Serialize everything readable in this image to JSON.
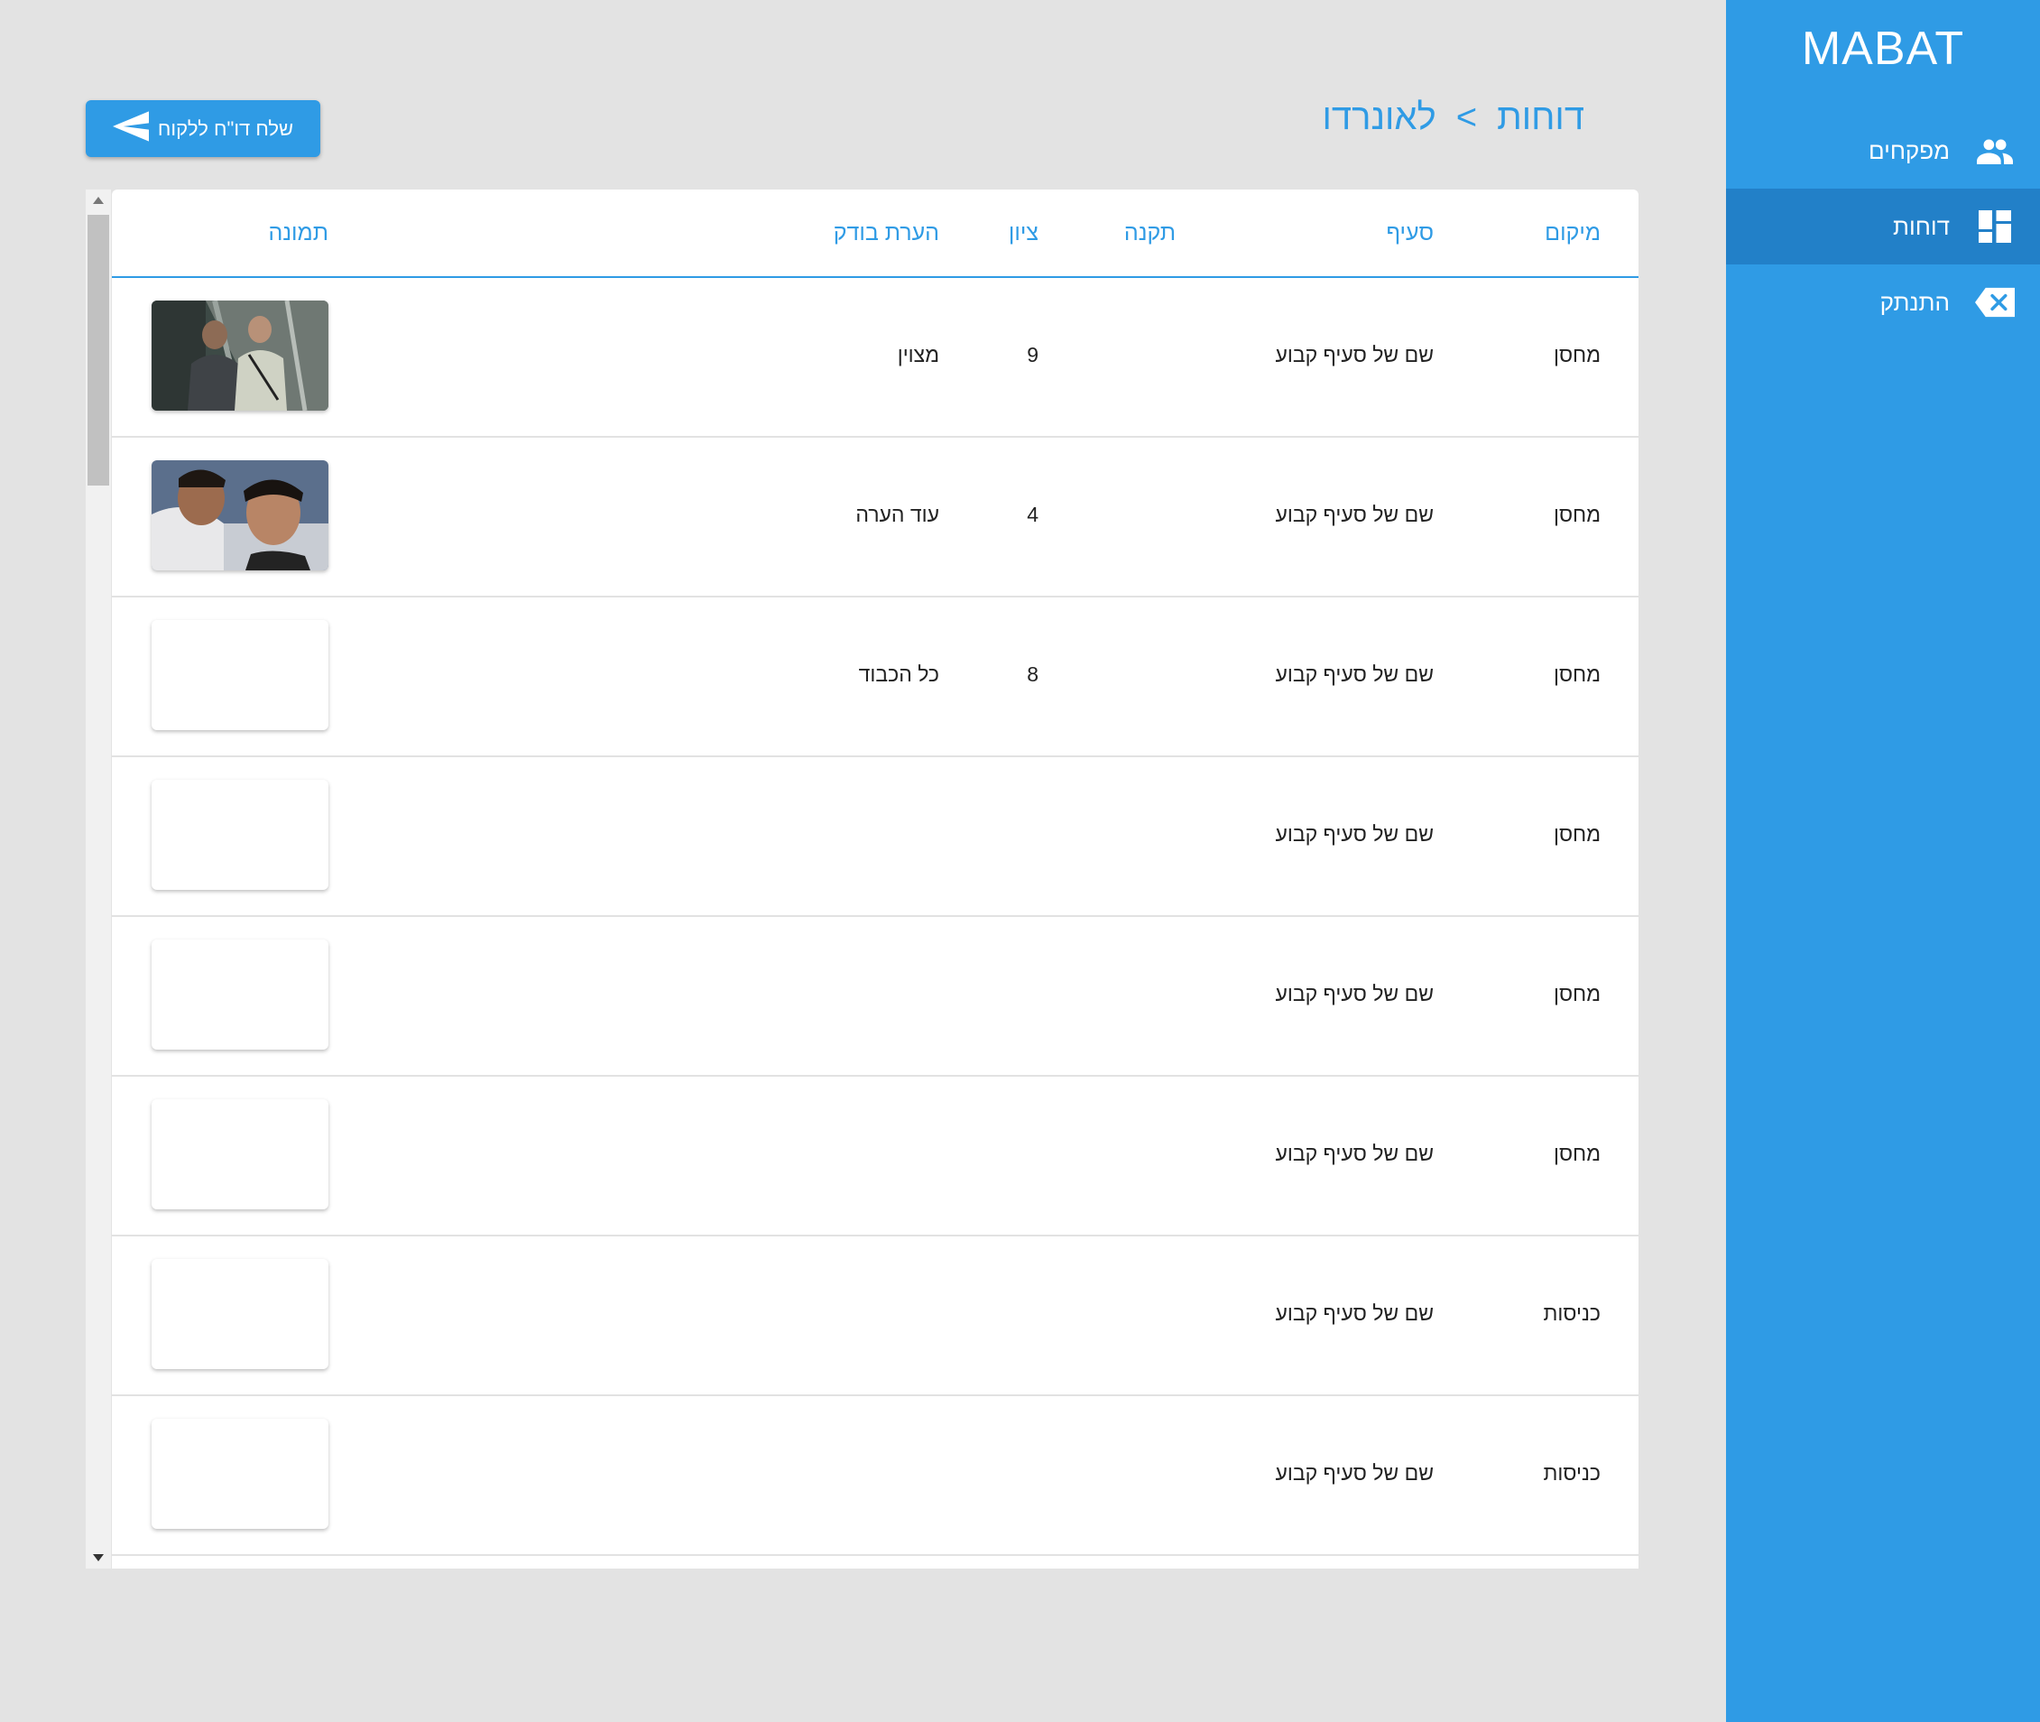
{
  "sidebar": {
    "brand": "MABAT",
    "items": [
      {
        "label": "מפקחים",
        "icon": "people-icon",
        "active": false
      },
      {
        "label": "דוחות",
        "icon": "dashboard-icon",
        "active": true
      },
      {
        "label": "התנתק",
        "icon": "backspace-icon",
        "active": false
      }
    ]
  },
  "header": {
    "breadcrumb": [
      "דוחות",
      ">",
      "לאונרדו"
    ],
    "send_button": {
      "label": "שלח דו\"ח ללקוח",
      "icon": "send-icon"
    }
  },
  "table": {
    "columns": {
      "location": "מיקום",
      "section": "סעיף",
      "regulation": "תקנה",
      "score": "ציון",
      "inspector_note": "הערת בודק",
      "image": "תמונה"
    },
    "rows": [
      {
        "location": "מחסן",
        "section": "שם של סעיף קבוע",
        "regulation": "",
        "score": "9",
        "note": "מצוין",
        "image": "photo-two-people-escalator"
      },
      {
        "location": "מחסן",
        "section": "שם של סעיף קבוע",
        "regulation": "",
        "score": "4",
        "note": "עוד הערה",
        "image": "photo-selfie-two-people"
      },
      {
        "location": "מחסן",
        "section": "שם של סעיף קבוע",
        "regulation": "",
        "score": "8",
        "note": "כל הכבוד",
        "image": ""
      },
      {
        "location": "מחסן",
        "section": "שם של סעיף קבוע",
        "regulation": "",
        "score": "",
        "note": "",
        "image": ""
      },
      {
        "location": "מחסן",
        "section": "שם של סעיף קבוע",
        "regulation": "",
        "score": "",
        "note": "",
        "image": ""
      },
      {
        "location": "מחסן",
        "section": "שם של סעיף קבוע",
        "regulation": "",
        "score": "",
        "note": "",
        "image": ""
      },
      {
        "location": "כניסות",
        "section": "שם של סעיף קבוע",
        "regulation": "",
        "score": "",
        "note": "",
        "image": ""
      },
      {
        "location": "כניסות",
        "section": "שם של סעיף קבוע",
        "regulation": "",
        "score": "",
        "note": "",
        "image": ""
      }
    ]
  },
  "colors": {
    "primary": "#2f9be5",
    "primary_dark": "#2280c8",
    "background": "#e3e3e3"
  }
}
